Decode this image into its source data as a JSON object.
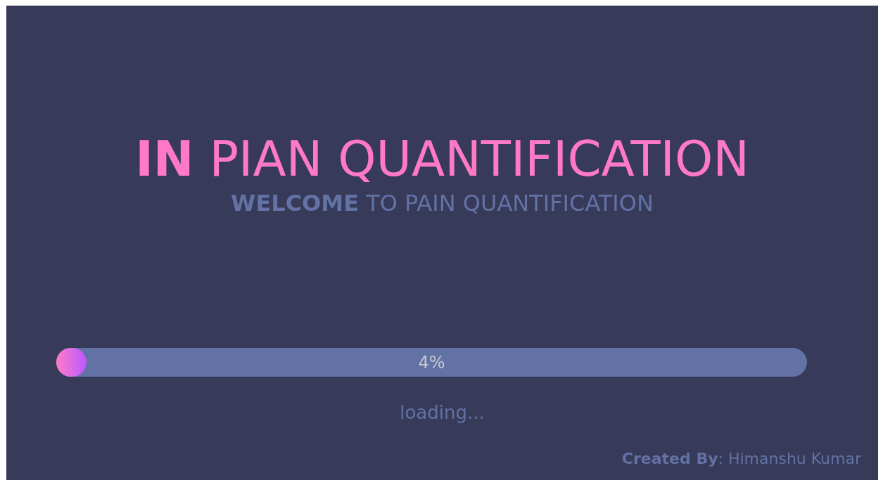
{
  "title": "**IN** PIAN QUANTIFICATION",
  "subtitle": "**WELCOME** TO PAIN QUANTIFICATION",
  "progress": {
    "level": 0.04,
    "reading": "4%"
  },
  "status": "loading...",
  "footer": "**Created By**: Himanshu Kumar"
}
